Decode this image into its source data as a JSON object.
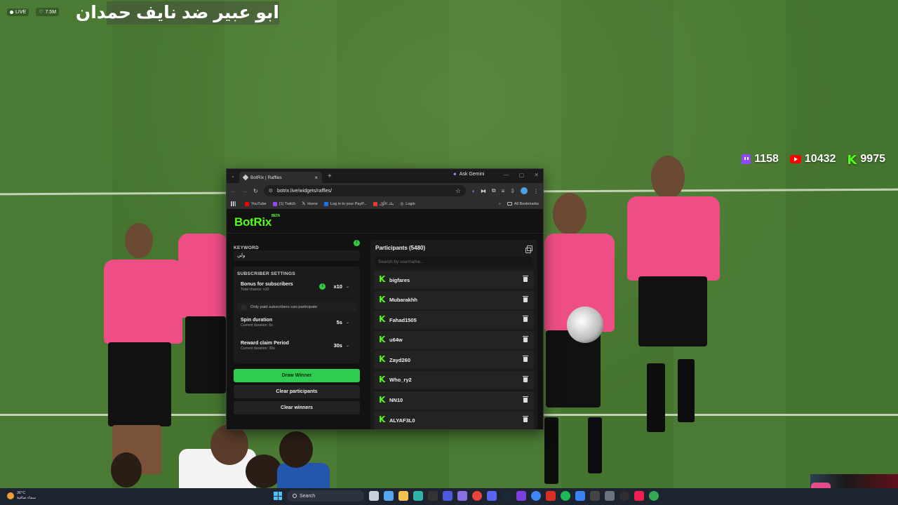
{
  "stream": {
    "live_label": "LIVE",
    "viewers": "7.5M",
    "banner_title": "ابو عبير ضد نايف حمدان",
    "counters": [
      {
        "platform": "twitch",
        "icon": "twitch-icon",
        "value": "1158",
        "color": "#9146ff"
      },
      {
        "platform": "youtube",
        "icon": "youtube-icon",
        "value": "10432",
        "color": "#ff0000"
      },
      {
        "platform": "kick",
        "icon": "kick-icon",
        "value": "9975",
        "color": "#53fc18"
      }
    ]
  },
  "browser": {
    "tab_title": "BotRix | Raffles",
    "gemini_label": "Ask Gemini",
    "url": "botrix.live/widgets/raffles/",
    "bookmarks": [
      {
        "label": "YouTube",
        "color": "#ff0000"
      },
      {
        "label": "(1) Twitch",
        "color": "#9146ff"
      },
      {
        "label": "Home",
        "color": "#ffffff"
      },
      {
        "label": "Log in to your PayP...",
        "color": "#1a73e8"
      },
      {
        "label": "بنك الأوّل",
        "color": "#e53935"
      },
      {
        "label": "Login",
        "color": "#cccccc"
      }
    ],
    "all_bookmarks_label": "All Bookmarks"
  },
  "app": {
    "logo": "BotRix",
    "logo_badge": "BETA",
    "keyword_label": "KEYWORD",
    "keyword_value": "ولي",
    "subscriber_settings_label": "SUBSCRIBER SETTINGS",
    "bonus": {
      "title": "Bonus for subscribers",
      "sub": "Total chance: x10",
      "value": "x10"
    },
    "only_paid_label": "Only paid subscribers can participate",
    "spin": {
      "title": "Spin duration",
      "sub": "Current duration: 5s",
      "value": "5s"
    },
    "reward": {
      "title": "Reward claim Period",
      "sub": "Current duration: 30s",
      "value": "30s"
    },
    "draw_winner": "Draw Winner",
    "clear_participants": "Clear participants",
    "clear_winners": "Clear winners",
    "accent_color": "#2ecc50"
  },
  "participants": {
    "title": "Participants (5480)",
    "search_placeholder": "Search by username...",
    "items": [
      "bigfares",
      "Mubarakhh",
      "Fahad1505",
      "u64w",
      "Zayd260",
      "Who_ry2",
      "NN10",
      "ALYAF3L0"
    ]
  },
  "taskbar": {
    "weather_temp": "36°C",
    "weather_desc": "سماء صافية",
    "search_label": "Search"
  }
}
